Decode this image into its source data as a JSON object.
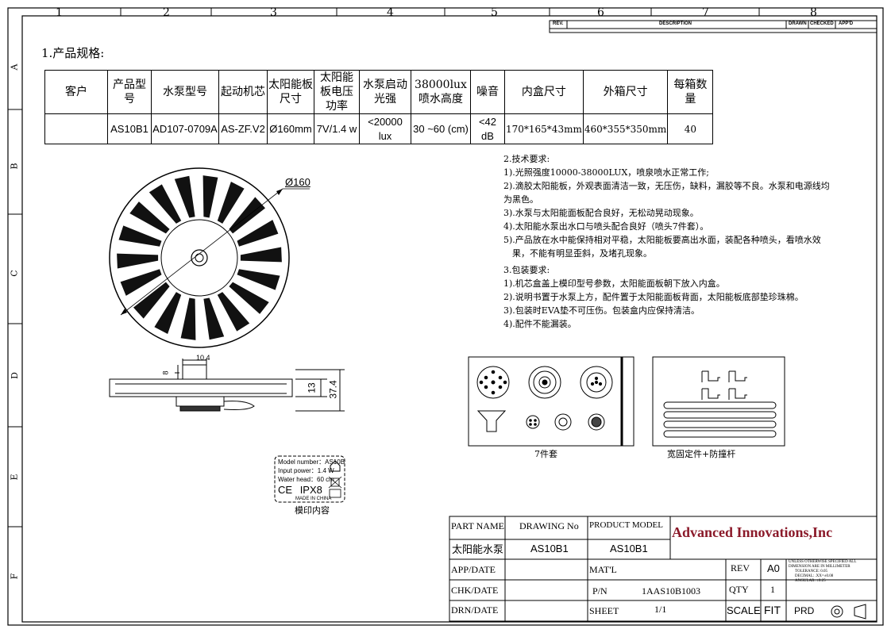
{
  "frame": {
    "col_numbers": [
      "1",
      "2",
      "3",
      "4",
      "5",
      "6",
      "7",
      "8"
    ],
    "row_letters": [
      "A",
      "B",
      "C",
      "D",
      "E",
      "F"
    ]
  },
  "revision_block": {
    "rev": "REV.",
    "description": "DESCRIPTION",
    "drawn": "DRAWN",
    "checked": "CHECKED",
    "appd": "APP'D"
  },
  "spec": {
    "section_title": "1.产品规格:",
    "headers": [
      "客户",
      "产品型号",
      "水泵型号",
      "起动机芯",
      "太阳能板尺寸",
      "太阳能板电压功率",
      "水泵启动光强",
      "38000lux喷水高度",
      "噪音",
      "内盒尺寸",
      "外箱尺寸",
      "每箱数量"
    ],
    "values": [
      "",
      "AS10B1",
      "AD107-0709A",
      "AS-ZF.V2",
      "Ø160mm",
      "7V/1.4 w",
      "<20000 lux",
      "30 ~60 (cm)",
      "<42 dB",
      "170*165*43mm",
      "460*355*350mm",
      "40"
    ]
  },
  "dims": {
    "diameter": "Ø160",
    "width_top": "10.4",
    "height_small": "8",
    "height_13": "13",
    "height_total": "37.4"
  },
  "tech": {
    "title": "2.技术要求:",
    "items": [
      "1).光照强度10000-38000LUX，喷泉喷水正常工作;",
      "2).滴胶太阳能板，外观表面清洁一致，无压伤，缺料，漏胶等不良。水泵和电源线均",
      "为黑色。",
      "3).水泵与太阳能面板配合良好，无松动晃动现象。",
      "4).太阳能水泵出水口与喷头配合良好（喷头7件套）。",
      "5).产品放在水中能保持相对平稳，太阳能板要高出水面，装配各种喷头，看喷水效",
      "　果，不能有明显歪斜，及堵孔现象。"
    ]
  },
  "pack": {
    "title": "3.包装要求:",
    "items": [
      "1).机芯盒盖上模印型号参数，太阳能面板朝下放入内盒。",
      "2).说明书置于水泵上方，配件置于太阳能面板背面，太阳能板底部垫珍珠棉。",
      "3).包装时EVA垫不可压伤。包装盒内应保持清洁。",
      "4).配件不能漏装。"
    ]
  },
  "label_box": {
    "model": "Model number：AS10B",
    "power": "Input power：1.4 W",
    "head": "Water head：60 cm",
    "ce": "CE",
    "ipx": "IPX8",
    "made": "MADE IN CHINA",
    "caption": "模印内容"
  },
  "accessories": {
    "nozzles_caption": "7件套",
    "stakes_caption": "宽固定件+防撞杆"
  },
  "title_block": {
    "part_name_label": "PART NAME",
    "drawing_no_label": "DRAWING No",
    "product_model_label": "PRODUCT MODEL",
    "company": "Advanced Innovations,Inc",
    "part_name": "太阳能水泵",
    "drawing_no": "AS10B1",
    "product_model": "AS10B1",
    "app_date": "APP/DATE",
    "chk_date": "CHK/DATE",
    "drn_date": "DRN/DATE",
    "matl": "MAT'L",
    "pn_label": "P/N",
    "pn": "1AAS10B1003",
    "sheet_label": "SHEET",
    "sheet": "1/1",
    "rev_label": "REV",
    "rev": "A0",
    "qty_label": "QTY",
    "qty": "1",
    "scale_label": "SCALE",
    "scale": "FIT",
    "prd": "PRD",
    "tolerance": [
      "UNLESS OTHERWISE SPECIFIED ALL",
      "DIMENSION ARE IN MILLIMETER",
      "TOLERANCE:    0.05",
      "DECIMAL:    .XX=±0.08",
      "ANGULAR:    ±0.25"
    ]
  },
  "colors": {
    "company": "#8b1a2a",
    "line": "#000000"
  }
}
